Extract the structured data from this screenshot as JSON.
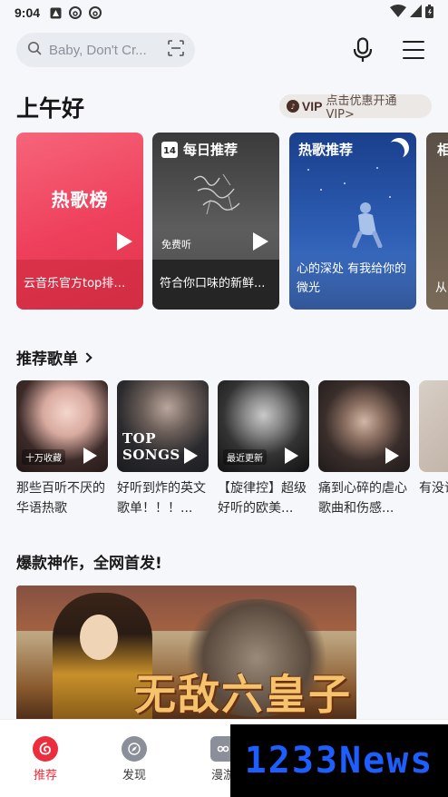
{
  "status_bar": {
    "time": "9:04"
  },
  "search": {
    "placeholder": "Baby, Don't Cr..."
  },
  "greeting": "上午好",
  "vip": {
    "label": "VIP",
    "promo": "点击优惠开通VIP>"
  },
  "top_cards": [
    {
      "title": "热歌榜",
      "caption": "云音乐官方top排行..."
    },
    {
      "header": "每日推荐",
      "calendar_day": "14",
      "badge": "免费听",
      "caption": "符合你口味的新鲜..."
    },
    {
      "header": "热歌推荐",
      "caption": "心的深处 有我给你的微光"
    },
    {
      "header": "相",
      "caption": "从"
    }
  ],
  "playlist_section": {
    "title": "推荐歌单"
  },
  "playlists": [
    {
      "badge": "十万收藏",
      "title": "那些百听不厌的华语热歌"
    },
    {
      "cover_text": "TOP SONGS",
      "title": "好听到炸的英文歌单！！！..."
    },
    {
      "badge": "最近更新",
      "title": "【旋律控】超级好听的欧美..."
    },
    {
      "title": "痛到心碎的虐心歌曲和伤感..."
    },
    {
      "title": "有没词直"
    }
  ],
  "banner_section": {
    "title": "爆款神作，全网首发!",
    "banner_text": "无敌六皇子"
  },
  "bottom_nav": [
    {
      "label": "推荐",
      "active": true
    },
    {
      "label": "发现",
      "active": false
    },
    {
      "label": "漫游",
      "active": false
    }
  ],
  "watermark": "1233News",
  "colors": {
    "accent": "#ec2d3d",
    "background": "#f5f7fa"
  }
}
